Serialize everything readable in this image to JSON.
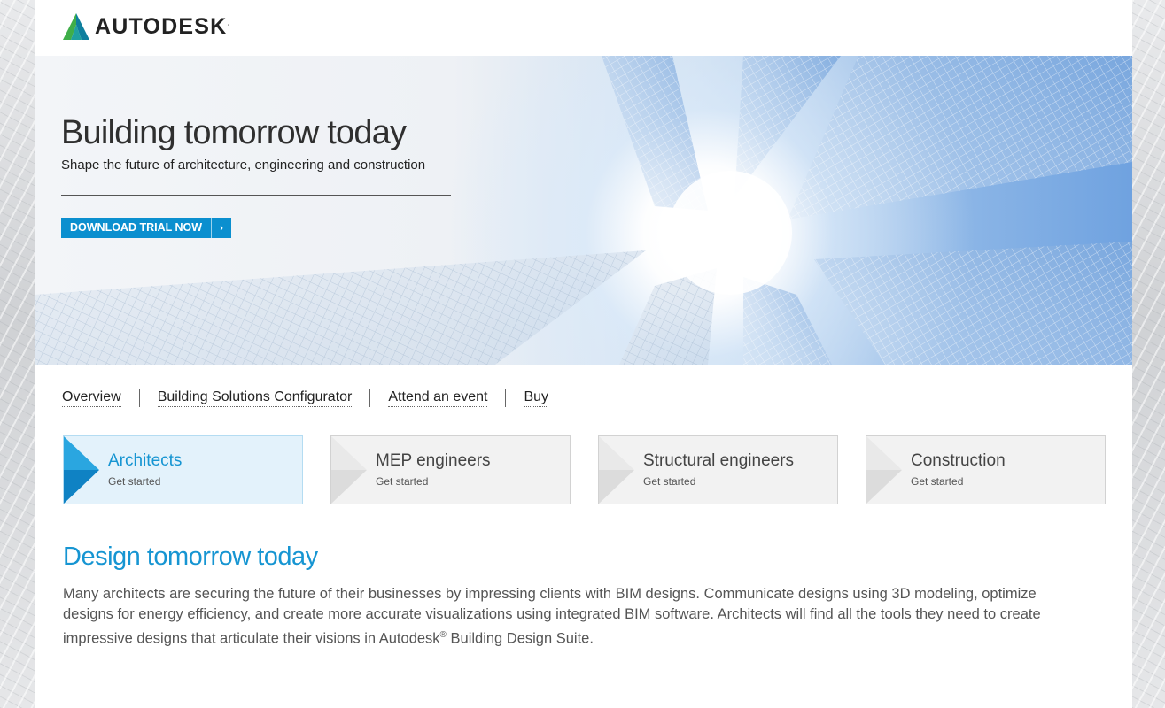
{
  "brand": {
    "name": "AUTODESK",
    "trademark": ".",
    "logo_icon": "autodesk-a-logo-icon",
    "colors": {
      "blue": "#1695d2",
      "cta": "#0b8fcf",
      "green": "#3fae49",
      "teal": "#0f8a8a"
    }
  },
  "hero": {
    "title": "Building tomorrow today",
    "subtitle": "Shape the future of architecture, engineering and construction",
    "cta_label": "DOWNLOAD TRIAL NOW",
    "cta_icon": "chevron-right-icon"
  },
  "subnav": {
    "items": [
      "Overview",
      "Building Solutions Configurator",
      "Attend an event",
      "Buy"
    ]
  },
  "roles": {
    "items": [
      {
        "title": "Architects",
        "sub": "Get started",
        "active": true
      },
      {
        "title": "MEP engineers",
        "sub": "Get started",
        "active": false
      },
      {
        "title": "Structural engineers",
        "sub": "Get started",
        "active": false
      },
      {
        "title": "Construction",
        "sub": "Get started",
        "active": false
      }
    ]
  },
  "section": {
    "title": "Design tomorrow today",
    "body_before": "Many architects are securing the future of their businesses by impressing clients with BIM designs. Communicate designs using 3D modeling, optimize designs for energy efficiency, and create more accurate visualizations using integrated BIM software. Architects will find all the tools they need to create impressive designs that articulate their visions in Autodesk",
    "registered_mark": "®",
    "body_after": " Building Design Suite."
  }
}
